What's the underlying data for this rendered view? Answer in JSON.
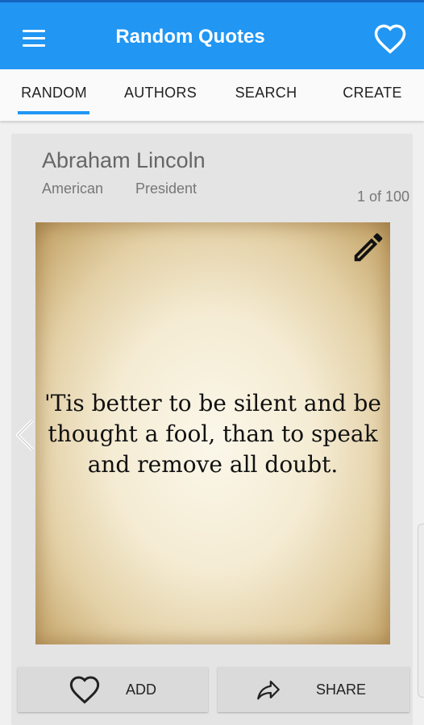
{
  "app": {
    "title": "Random Quotes"
  },
  "tabs": [
    {
      "label": "RANDOM"
    },
    {
      "label": "AUTHORS"
    },
    {
      "label": "SEARCH"
    },
    {
      "label": "CREATE"
    }
  ],
  "active_tab": 0,
  "author": {
    "name": "Abraham Lincoln",
    "nationality": "American",
    "profession": "President"
  },
  "counter": "1 of 100",
  "quote": {
    "lines": [
      "'Tis better to be silent and be",
      "thought a fool, than to speak",
      "and remove all doubt."
    ]
  },
  "actions": {
    "add_label": "ADD",
    "share_label": "SHARE"
  },
  "icons": {
    "menu": "menu-icon",
    "favorite": "heart-outline-icon",
    "edit": "pencil-icon",
    "previous": "chevron-left-icon",
    "add": "heart-outline-icon",
    "share": "share-arrow-icon"
  },
  "colors": {
    "primary": "#2196f3",
    "primary_dark": "#1565c0",
    "tab_indicator": "#2196f3"
  }
}
